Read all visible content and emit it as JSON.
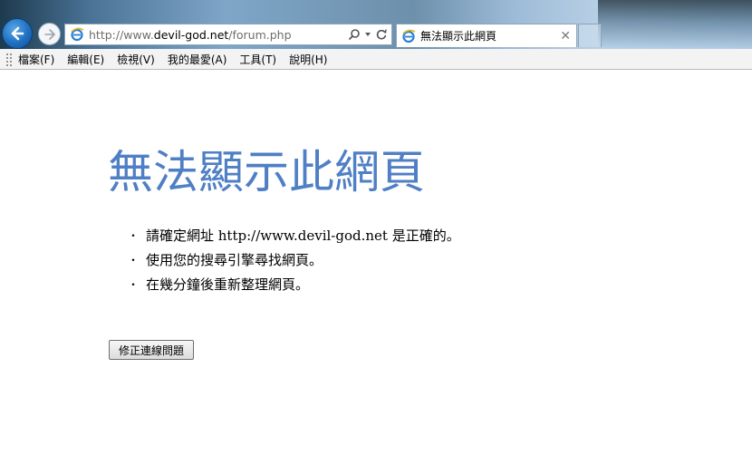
{
  "browser": {
    "address": {
      "url_prefix": "http://www.",
      "url_host": "devil-god.net",
      "url_path": "/forum.php"
    },
    "tab": {
      "title": "無法顯示此網頁"
    },
    "colors": {
      "accent": "#1f6fc0",
      "heading": "#4f7fc4"
    }
  },
  "menu": {
    "items": [
      "檔案(F)",
      "編輯(E)",
      "檢視(V)",
      "我的最愛(A)",
      "工具(T)",
      "說明(H)"
    ]
  },
  "content": {
    "heading": "無法顯示此網頁",
    "tips": [
      "請確定網址 http://www.devil-god.net 是正確的。",
      "使用您的搜尋引擎尋找網頁。",
      "在幾分鐘後重新整理網頁。"
    ],
    "bullet": "・",
    "fix_button": "修正連線問題"
  },
  "icons": {
    "back": "arrow-left-icon",
    "forward": "arrow-right-icon",
    "site": "ie-icon",
    "search": "search-icon",
    "dropdown": "chevron-down-icon",
    "refresh": "refresh-icon",
    "close": "close-icon"
  }
}
